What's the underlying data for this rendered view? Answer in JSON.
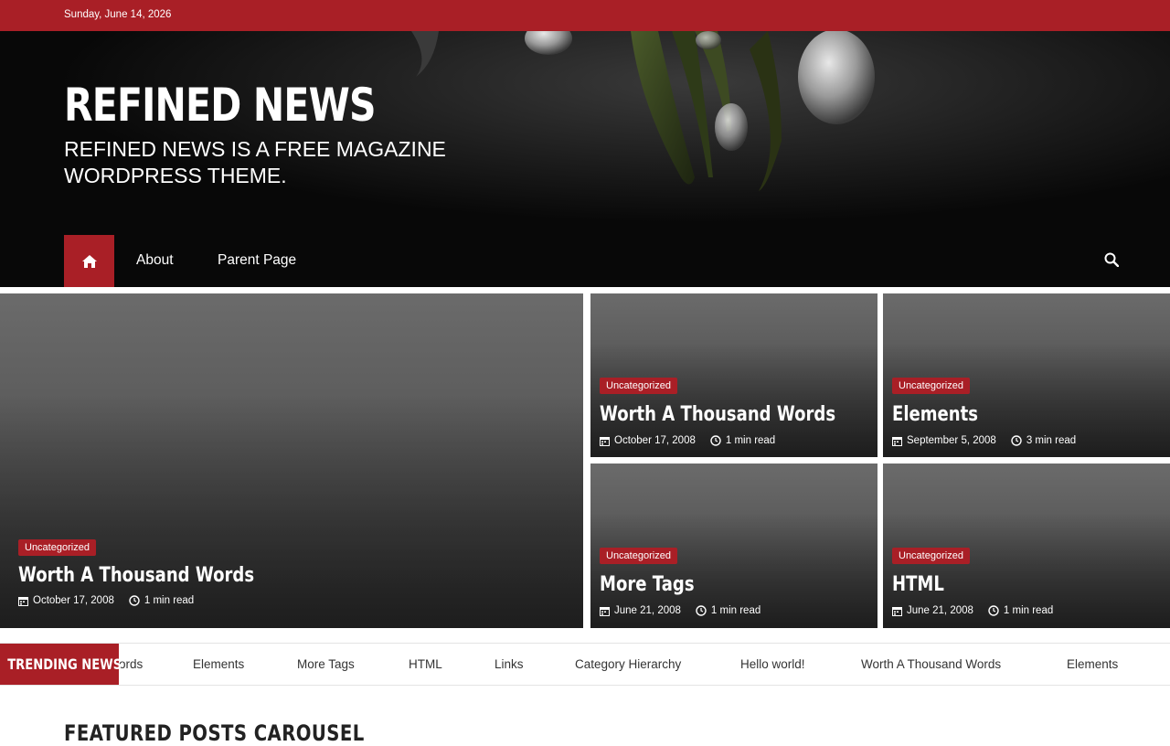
{
  "topbar": {
    "date": "Sunday, June 14, 2026"
  },
  "site": {
    "title": "REFINED NEWS",
    "tagline": "REFINED NEWS IS A FREE MAGAZINE WORDPRESS THEME."
  },
  "nav": {
    "home_icon": "home-icon",
    "items": [
      "About",
      "Parent Page"
    ],
    "search_icon": "search-icon"
  },
  "featured": {
    "main": {
      "category": "Uncategorized",
      "title": "Worth A Thousand Words",
      "date": "October 17, 2008",
      "read": "1 min read"
    },
    "grid": [
      {
        "category": "Uncategorized",
        "title": "Worth A Thousand Words",
        "date": "October 17, 2008",
        "read": "1 min read"
      },
      {
        "category": "Uncategorized",
        "title": "Elements",
        "date": "September 5, 2008",
        "read": "3 min read"
      },
      {
        "category": "Uncategorized",
        "title": "More Tags",
        "date": "June 21, 2008",
        "read": "1 min read"
      },
      {
        "category": "Uncategorized",
        "title": "HTML",
        "date": "June 21, 2008",
        "read": "1 min read"
      }
    ]
  },
  "trending": {
    "label": "TRENDING NEWS",
    "items": [
      "ords",
      "Elements",
      "More Tags",
      "HTML",
      "Links",
      "Category Hierarchy",
      "Hello world!",
      "Worth A Thousand Words",
      "Elements"
    ]
  },
  "carousel": {
    "title": "FEATURED POSTS CAROUSEL"
  },
  "colors": {
    "accent": "#a91f26",
    "header_bg": "#080808"
  }
}
